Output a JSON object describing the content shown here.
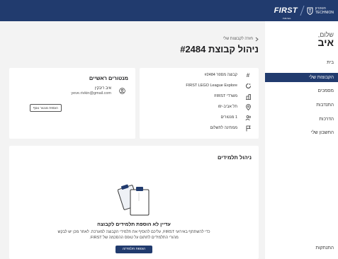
{
  "header": {
    "brand": "FIRST",
    "brand_sub": "ISRAEL",
    "technion_he": "הטכניון",
    "technion_en": "TECHNION"
  },
  "sidebar": {
    "greeting": "שלום,",
    "user_name": "איב",
    "items": [
      {
        "label": "בית",
        "active": false
      },
      {
        "label": "הקבוצות שלי",
        "active": true
      },
      {
        "label": "מסמכים",
        "active": false
      },
      {
        "label": "התנדבות",
        "active": false
      },
      {
        "label": "הדרכות",
        "active": false
      },
      {
        "label": "החשבון שלי",
        "active": false
      }
    ],
    "logout": "התנתקות"
  },
  "main": {
    "breadcrumb": {
      "back_icon": "chevron-right-icon",
      "label": "חזרה לקבוצות שלי"
    },
    "title": "ניהול קבוצת #2484",
    "team_info": [
      {
        "icon": "hash-icon",
        "text": "קבוצה מספר #2484"
      },
      {
        "icon": "program-icon",
        "text": "FIRST LEGO League Explore"
      },
      {
        "icon": "building-icon",
        "text": "משרדי FIRST"
      },
      {
        "icon": "location-pin-icon",
        "text": "תל אביב-יפו"
      },
      {
        "icon": "users-icon",
        "text": "1 מנטורים"
      },
      {
        "icon": "flag-icon",
        "text": "ממתינה לתשלום"
      }
    ],
    "mentors": {
      "title": "מנטורים ראשיים",
      "name": "איב ריבקין",
      "email": "yeve.rivkin@gmail.com",
      "add_button": "הוספת מנטור נוסף"
    },
    "students": {
      "title": "ניהול תלמידים",
      "empty_title": "עדיין לא הוספת תלמידים לקבוצה",
      "empty_line1": "כדי להשתתף באירועי FIRST, עליכם להוסיף את תלמידי הקבוצה למערכת. לאחר מכן יש לבקש",
      "empty_line2": "מהורי התלמידים לחתום על טופס ההסכמה של FIRST.",
      "add_button": "הוספת תלמיד/ה"
    }
  },
  "colors": {
    "primary": "#213b6e",
    "background": "#f3f3f3",
    "card": "#ffffff"
  }
}
